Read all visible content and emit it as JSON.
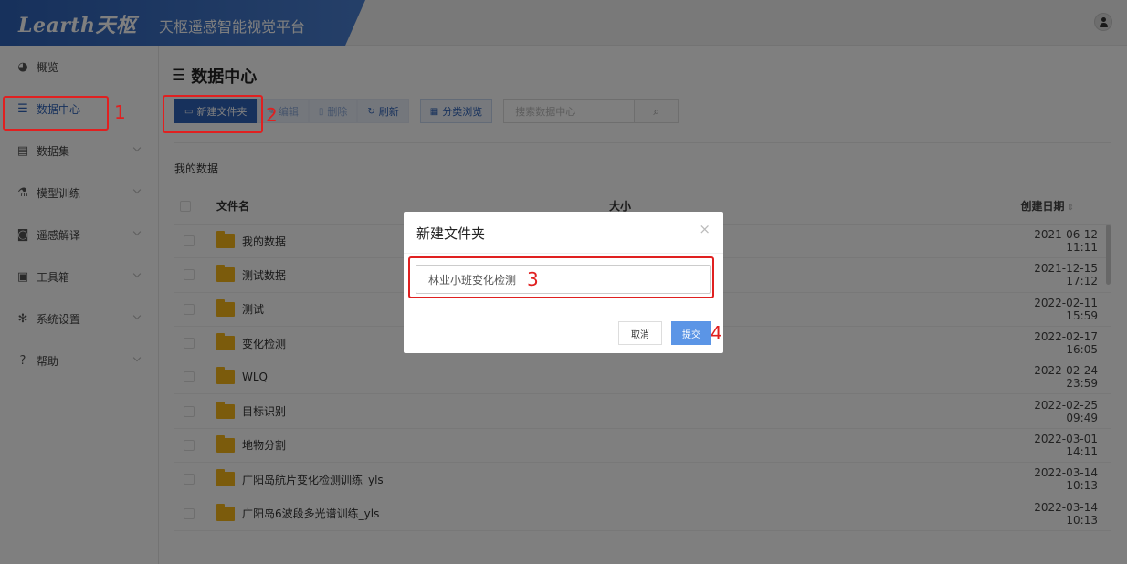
{
  "header": {
    "logo": "Learth天枢",
    "platform_title": "天枢遥感智能视觉平台"
  },
  "sidebar": {
    "items": [
      {
        "label": "概览",
        "icon": "pie-chart-icon",
        "glyph": "◕",
        "chevron": false,
        "active": false
      },
      {
        "label": "数据中心",
        "icon": "database-icon",
        "glyph": "☰",
        "chevron": false,
        "active": true
      },
      {
        "label": "数据集",
        "icon": "server-icon",
        "glyph": "▤",
        "chevron": true,
        "active": false
      },
      {
        "label": "模型训练",
        "icon": "flask-icon",
        "glyph": "⚗",
        "chevron": true,
        "active": false
      },
      {
        "label": "遥感解译",
        "icon": "robot-icon",
        "glyph": "◙",
        "chevron": true,
        "active": false
      },
      {
        "label": "工具箱",
        "icon": "toolbox-icon",
        "glyph": "▣",
        "chevron": true,
        "active": false
      },
      {
        "label": "系统设置",
        "icon": "gear-icon",
        "glyph": "✻",
        "chevron": true,
        "active": false
      },
      {
        "label": "帮助",
        "icon": "help-icon",
        "glyph": "?",
        "chevron": true,
        "active": false
      }
    ]
  },
  "main": {
    "page_title": "数据中心",
    "toolbar": {
      "new_folder": "新建文件夹",
      "edit": "编辑",
      "delete": "删除",
      "refresh": "刷新",
      "browse": "分类浏览",
      "search_placeholder": "搜索数据中心"
    },
    "section_title": "我的数据",
    "table": {
      "columns": {
        "name": "文件名",
        "size": "大小",
        "date": "创建日期"
      },
      "rows": [
        {
          "name": "我的数据",
          "date": "2021-06-12 11:11"
        },
        {
          "name": "测试数据",
          "date": "2021-12-15 17:12"
        },
        {
          "name": "测试",
          "date": "2022-02-11 15:59"
        },
        {
          "name": "变化检测",
          "date": "2022-02-17 16:05"
        },
        {
          "name": "WLQ",
          "date": "2022-02-24 23:59"
        },
        {
          "name": "目标识别",
          "date": "2022-02-25 09:49"
        },
        {
          "name": "地物分割",
          "date": "2022-03-01 14:11"
        },
        {
          "name": "广阳岛航片变化检测训练_yls",
          "date": "2022-03-14 10:13"
        },
        {
          "name": "广阳岛6波段多光谱训练_yls",
          "date": "2022-03-14 10:13"
        }
      ]
    }
  },
  "modal": {
    "title": "新建文件夹",
    "input_value": "林业小班变化检测",
    "cancel": "取消",
    "submit": "提交"
  },
  "annotations": {
    "step1": "1",
    "step2": "2",
    "step3": "3",
    "step4": "4"
  },
  "colors": {
    "brand": "#2e62b8",
    "annotation": "#e02020",
    "folder": "#f6b619"
  }
}
